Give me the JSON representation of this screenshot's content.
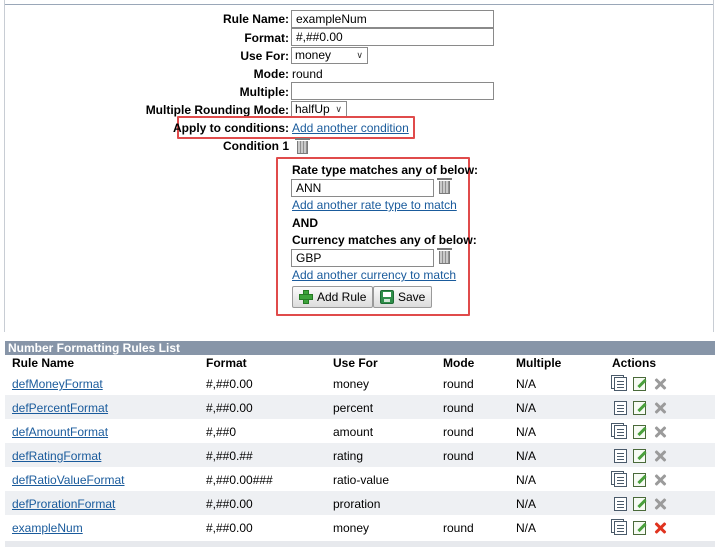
{
  "form": {
    "rule_name_label": "Rule Name:",
    "rule_name_value": "exampleNum",
    "format_label": "Format:",
    "format_value": "#,##0.00",
    "use_for_label": "Use For:",
    "use_for_value": "money",
    "mode_label": "Mode:",
    "mode_value": "round",
    "multiple_label": "Multiple:",
    "multiple_value": "",
    "multiple_rounding_label": "Multiple Rounding Mode:",
    "multiple_rounding_value": "halfUp",
    "apply_label": "Apply to conditions:",
    "add_condition_link": "Add another condition",
    "condition_label": "Condition 1"
  },
  "condition": {
    "rate_label": "Rate type matches any of below:",
    "rate_value": "ANN",
    "add_rate_link": "Add another rate type to match",
    "and_label": "AND",
    "currency_label": "Currency matches any of below:",
    "currency_value": "GBP",
    "add_currency_link": "Add another currency to match",
    "add_rule_button": "Add Rule",
    "save_button": "Save"
  },
  "table": {
    "title": "Number Formatting Rules List",
    "headers": [
      "Rule Name",
      "Format",
      "Use For",
      "Mode",
      "Multiple",
      "Actions"
    ],
    "rows": [
      {
        "name": "defMoneyFormat",
        "format": "#,##0.00",
        "use": "money",
        "mode": "round",
        "multiple": "N/A"
      },
      {
        "name": "defPercentFormat",
        "format": "#,##0.00",
        "use": "percent",
        "mode": "round",
        "multiple": "N/A"
      },
      {
        "name": "defAmountFormat",
        "format": "#,##0",
        "use": "amount",
        "mode": "round",
        "multiple": "N/A"
      },
      {
        "name": "defRatingFormat",
        "format": "#,##0.##",
        "use": "rating",
        "mode": "round",
        "multiple": "N/A"
      },
      {
        "name": "defRatioValueFormat",
        "format": "#,##0.00###",
        "use": "ratio-value",
        "mode": "",
        "multiple": "N/A"
      },
      {
        "name": "defProrationFormat",
        "format": "#,##0.00",
        "use": "proration",
        "mode": "",
        "multiple": "N/A"
      },
      {
        "name": "exampleNum",
        "format": "#,##0.00",
        "use": "money",
        "mode": "round",
        "multiple": "N/A"
      }
    ]
  },
  "icons": {
    "copy": "copy-icon",
    "edit": "edit-icon",
    "delete": "delete-icon",
    "trash": "trash-icon",
    "add": "plus-icon",
    "save": "save-icon"
  },
  "colors": {
    "highlight_border": "#e04b4b",
    "table_title_bg": "#8795a8",
    "link": "#1a5b9c",
    "active_delete": "#e0331f"
  }
}
